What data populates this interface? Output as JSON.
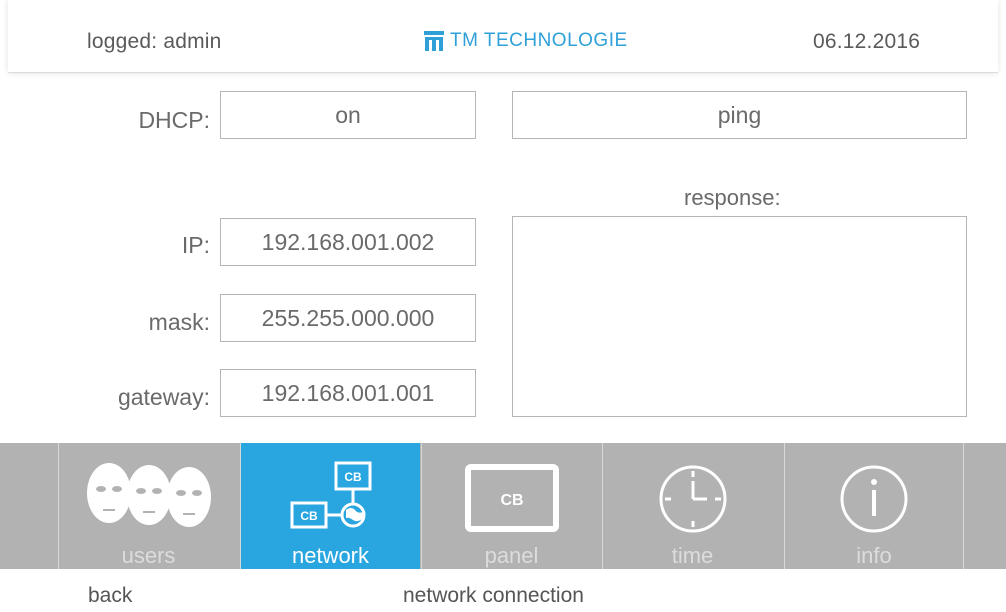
{
  "header": {
    "user_status": "logged: admin",
    "logo_text": "TM TECHNOLOGIE",
    "date": "06.12.2016"
  },
  "network": {
    "dhcp_label": "DHCP:",
    "dhcp_value": "on",
    "ping_label": "ping",
    "response_label": "response:",
    "response_value": "",
    "ip_label": "IP:",
    "ip_value": "192.168.001.002",
    "mask_label": "mask:",
    "mask_value": "255.255.000.000",
    "gateway_label": "gateway:",
    "gateway_value": "192.168.001.001"
  },
  "nav": {
    "tabs": [
      {
        "label": "users",
        "icon": "users-icon"
      },
      {
        "label": "network",
        "icon": "network-icon",
        "active": true
      },
      {
        "label": "panel",
        "icon": "panel-icon"
      },
      {
        "label": "time",
        "icon": "clock-icon"
      },
      {
        "label": "info",
        "icon": "info-icon"
      }
    ],
    "network_icon_text": "CB",
    "panel_icon_text": "CB"
  },
  "footer": {
    "back_label": "back",
    "page_title": "network connection"
  },
  "colors": {
    "accent": "#29a6e0",
    "nav_bg": "#b2b2b2",
    "logo": "#2fa0d8"
  }
}
